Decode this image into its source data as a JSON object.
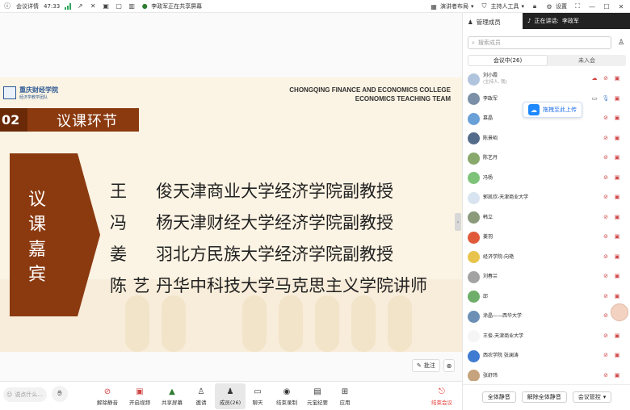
{
  "topbar": {
    "meeting_info_label": "会议详情",
    "duration": "47:33",
    "share_status": "李政军正在共享屏幕",
    "presenter_layout": "演讲者布局",
    "host_tools": "主持人工具",
    "settings": "设置"
  },
  "slide": {
    "logo_title": "重庆财经学院",
    "logo_subtitle": "经济学教学团队",
    "english_line1": "CHONGQING FINANCE AND ECONOMICS COLLEGE",
    "english_line2": "ECONOMICS TEACHING TEAM",
    "section_number": "02",
    "section_title": "议课环节",
    "arrow_text": [
      "议",
      "课",
      "嘉",
      "宾"
    ],
    "guests": [
      {
        "name": "王　俊",
        "affiliation": "天津商业大学经济学院副教授"
      },
      {
        "name": "冯　杨",
        "affiliation": "天津财经大学经济学院副教授"
      },
      {
        "name": "姜　羽",
        "affiliation": "北方民族大学经济学院副教授"
      },
      {
        "name": "陈艺丹",
        "affiliation": "华中科技大学马克思主义学院讲师"
      }
    ],
    "annotate_label": "批注"
  },
  "toolbar": {
    "raise_hand_placeholder": "说点什么...",
    "items": [
      {
        "label": "解除静音",
        "icon": "mic-muted-icon"
      },
      {
        "label": "开启视频",
        "icon": "camera-off-icon"
      },
      {
        "label": "共享屏幕",
        "icon": "share-screen-icon"
      },
      {
        "label": "邀请",
        "icon": "invite-icon"
      },
      {
        "label": "成员(26)",
        "icon": "members-icon"
      },
      {
        "label": "聊天",
        "icon": "chat-icon"
      },
      {
        "label": "结束录制",
        "icon": "record-stop-icon"
      },
      {
        "label": "元宝纪要",
        "icon": "minutes-icon"
      },
      {
        "label": "应用",
        "icon": "apps-icon"
      }
    ],
    "end_meeting": "结束会议"
  },
  "panel": {
    "title": "管理成员",
    "now_speaking_label": "正在讲话:",
    "now_speaking_name": "李政军",
    "search_placeholder": "搜索成员",
    "tab_in_meeting": "会议中(26)",
    "tab_not_joined": "未入会",
    "upload_tip": "拖拽至此上传",
    "members": [
      {
        "name": "刘小霞",
        "sub": "(主持人, 我)",
        "color": "#b0c4de"
      },
      {
        "name": "李政军",
        "sub": "",
        "color": "#7b8fa6"
      },
      {
        "name": "慕晶",
        "sub": "",
        "color": "#6aa0d8"
      },
      {
        "name": "陈景昭",
        "sub": "",
        "color": "#556b8a"
      },
      {
        "name": "陈艺丹",
        "sub": "",
        "color": "#89a86b"
      },
      {
        "name": "冯杨",
        "sub": "",
        "color": "#7fc27a"
      },
      {
        "name": "郭凯欣-天津商业大学",
        "sub": "",
        "color": "#d8e4f0"
      },
      {
        "name": "韩立",
        "sub": "",
        "color": "#8a9a7b"
      },
      {
        "name": "姜羽",
        "sub": "",
        "color": "#e05a3a"
      },
      {
        "name": "经济学院-向艳",
        "sub": "",
        "color": "#e8c44c"
      },
      {
        "name": "刘春兰",
        "sub": "",
        "color": "#a3a3a3"
      },
      {
        "name": "邱",
        "sub": "",
        "color": "#6fae6a"
      },
      {
        "name": "涂晶——西华大学",
        "sub": "",
        "color": "#6c8fb5"
      },
      {
        "name": "王俊-天津商业大学",
        "sub": "",
        "color": "#f5f5f5"
      },
      {
        "name": "西农学院 张澜涛",
        "sub": "",
        "color": "#3f7bd1"
      },
      {
        "name": "张舒玮",
        "sub": "",
        "color": "#c4a37d"
      }
    ],
    "mute_all": "全体静音",
    "unmute_all": "解除全体静音",
    "meeting_control": "会议管控"
  }
}
